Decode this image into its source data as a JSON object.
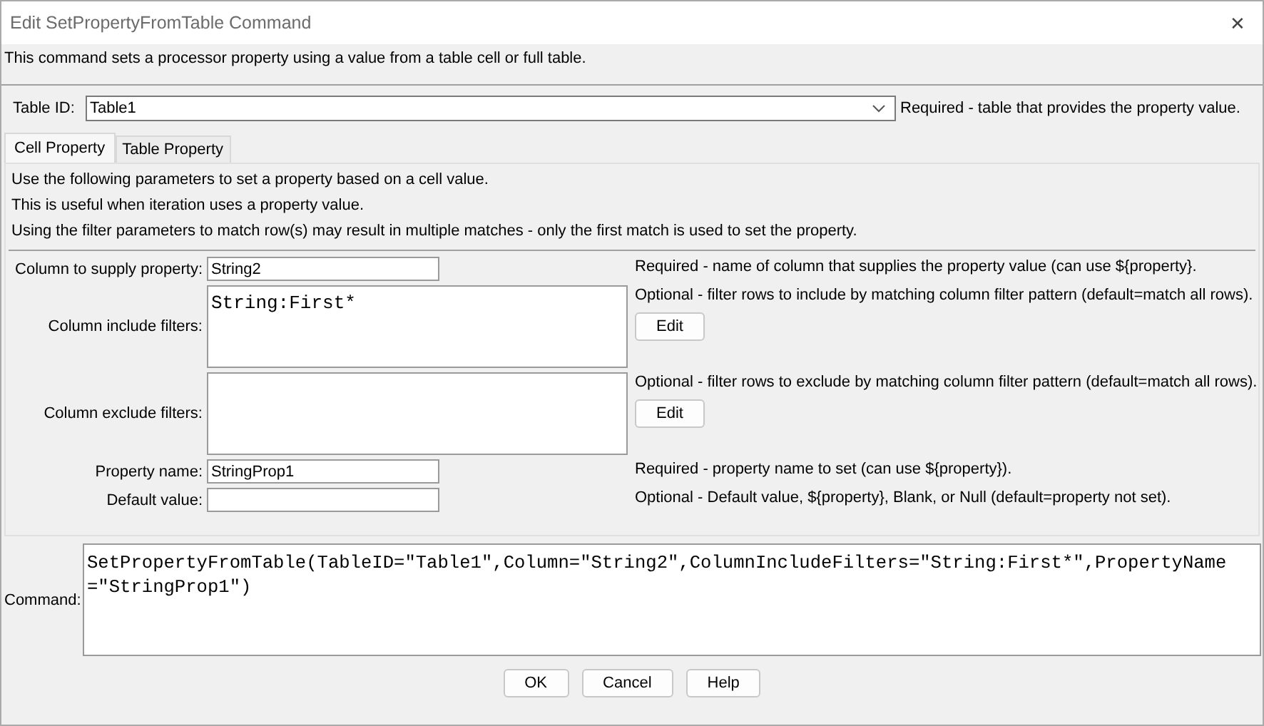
{
  "window": {
    "title": "Edit SetPropertyFromTable Command",
    "close": "✕"
  },
  "description": "This command sets a processor property using a value from a table cell or full table.",
  "table_id": {
    "label": "Table ID:",
    "value": "Table1",
    "note": "Required - table that provides the property value."
  },
  "tabs": [
    {
      "label": "Cell Property",
      "selected": true
    },
    {
      "label": "Table Property",
      "selected": false
    }
  ],
  "panel_notes": [
    "Use the following parameters to set a property based on a cell value.",
    "This is useful when iteration uses a property value.",
    "Using the filter parameters to match row(s) may result in multiple matches - only the first match is used to set the property."
  ],
  "params": [
    {
      "kind": "text",
      "label": "Column to supply property:",
      "value": "String2",
      "note": "Required - name of column that supplies the property value (can use ${property}."
    },
    {
      "kind": "multiline",
      "label": "Column include filters:",
      "value": "String:First*",
      "note": "Optional - filter rows to include by matching column filter pattern (default=match all rows).",
      "button": "Edit"
    },
    {
      "kind": "multiline",
      "label": "Column exclude filters:",
      "note": "Optional - filter rows to exclude by matching column filter pattern (default=match all rows).",
      "button": "Edit"
    },
    {
      "kind": "text",
      "label": "Property name:",
      "value": "StringProp1",
      "note": "Required - property name to set (can use ${property})."
    },
    {
      "kind": "text",
      "label": "Default value:",
      "note": "Optional - Default value, ${property}, Blank, or Null (default=property not set)."
    }
  ],
  "command": {
    "label": "Command:",
    "value": "SetPropertyFromTable(TableID=\"Table1\",Column=\"String2\",ColumnIncludeFilters=\"String:First*\",PropertyName=\"StringProp1\")"
  },
  "buttons": [
    "OK",
    "Cancel",
    "Help"
  ]
}
